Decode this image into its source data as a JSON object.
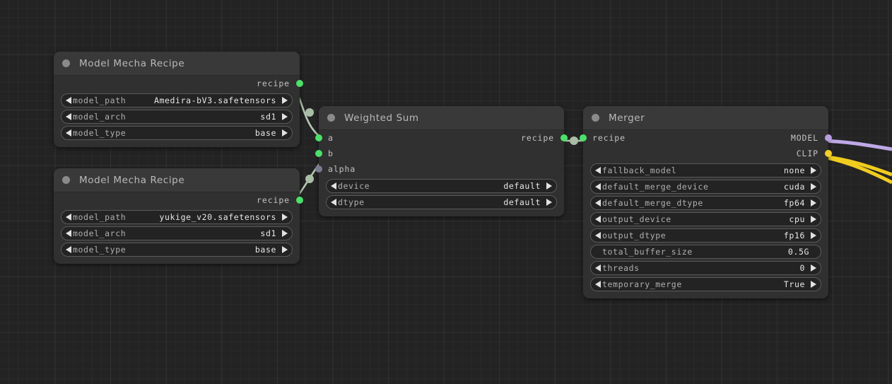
{
  "app": {
    "canvas_name": "node-graph-canvas"
  },
  "theme": {
    "bg": "#232323",
    "node_body": "#303030",
    "node_header": "#393939",
    "slot_recipe": "#4ce06a",
    "slot_alpha": "#7a7a92",
    "slot_model": "#b79de0",
    "slot_clip": "#f3cf28",
    "wire_recipe": "#b3c7b1",
    "wire_model": "#bfa8e6",
    "wire_clip": "#f0cc1f"
  },
  "nodes": [
    {
      "id": "model-mecha-recipe-1",
      "title": "Model Mecha Recipe",
      "outputs": [
        {
          "label": "recipe",
          "color_key": "slot_recipe"
        }
      ],
      "inputs": [],
      "widgets": [
        {
          "name": "model_path",
          "value": "Amedira-bV3.safetensors",
          "arrows": true
        },
        {
          "name": "model_arch",
          "value": "sd1",
          "arrows": true
        },
        {
          "name": "model_type",
          "value": "base",
          "arrows": true
        }
      ]
    },
    {
      "id": "model-mecha-recipe-2",
      "title": "Model Mecha Recipe",
      "outputs": [
        {
          "label": "recipe",
          "color_key": "slot_recipe"
        }
      ],
      "inputs": [],
      "widgets": [
        {
          "name": "model_path",
          "value": "yukige_v20.safetensors",
          "arrows": true
        },
        {
          "name": "model_arch",
          "value": "sd1",
          "arrows": true
        },
        {
          "name": "model_type",
          "value": "base",
          "arrows": true
        }
      ]
    },
    {
      "id": "weighted-sum",
      "title": "Weighted Sum",
      "inputs": [
        {
          "label": "a",
          "color_key": "slot_recipe"
        },
        {
          "label": "b",
          "color_key": "slot_recipe"
        },
        {
          "label": "alpha",
          "color_key": "slot_alpha"
        }
      ],
      "outputs": [
        {
          "label": "recipe",
          "color_key": "slot_recipe"
        }
      ],
      "widgets": [
        {
          "name": "device",
          "value": "default",
          "arrows": true
        },
        {
          "name": "dtype",
          "value": "default",
          "arrows": true
        }
      ]
    },
    {
      "id": "merger",
      "title": "Merger",
      "inputs": [
        {
          "label": "recipe",
          "color_key": "slot_recipe"
        }
      ],
      "outputs": [
        {
          "label": "MODEL",
          "color_key": "slot_model"
        },
        {
          "label": "CLIP",
          "color_key": "slot_clip"
        }
      ],
      "widgets": [
        {
          "name": "fallback_model",
          "value": "none",
          "arrows": true
        },
        {
          "name": "default_merge_device",
          "value": "cuda",
          "arrows": true
        },
        {
          "name": "default_merge_dtype",
          "value": "fp64",
          "arrows": true
        },
        {
          "name": "output_device",
          "value": "cpu",
          "arrows": true
        },
        {
          "name": "output_dtype",
          "value": "fp16",
          "arrows": true
        },
        {
          "name": "total_buffer_size",
          "value": "0.5G",
          "arrows": false
        },
        {
          "name": "threads",
          "value": "0",
          "arrows": true
        },
        {
          "name": "temporary_merge",
          "value": "True",
          "arrows": true
        }
      ]
    }
  ]
}
